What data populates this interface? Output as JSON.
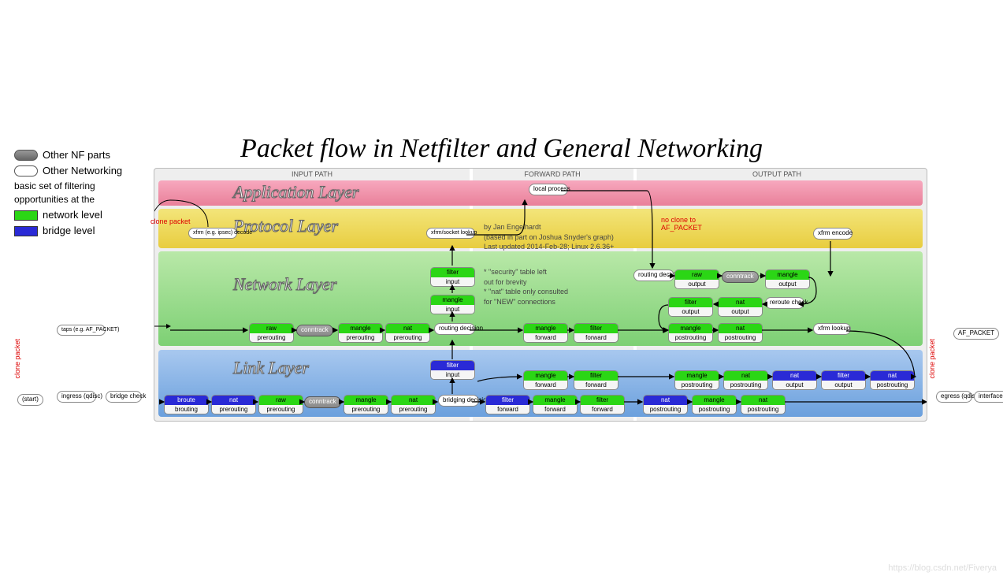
{
  "title": "Packet flow in Netfilter and General Networking",
  "legend": {
    "other_nf": "Other NF parts",
    "other_net": "Other Networking",
    "filtering": "basic set of filtering opportunities at the",
    "net_level": "network level",
    "bridge_level": "bridge level"
  },
  "headers": {
    "input": "INPUT PATH",
    "forward": "FORWARD PATH",
    "output": "OUTPUT PATH"
  },
  "layers": {
    "app": "Application Layer",
    "proto": "Protocol Layer",
    "net": "Network Layer",
    "link": "Link Layer"
  },
  "credits": {
    "l1": "by Jan Engelhardt",
    "l2": "(based in part on Joshua Snyder's graph)",
    "l3": "Last updated 2014-Feb-28; Linux 2.6.36+"
  },
  "notes": {
    "n1": "* \"security\" table left",
    "n2": "  out for brevity",
    "n3": "* \"nat\" table only consulted",
    "n4": "  for \"NEW\" connections"
  },
  "outer": {
    "start": "(start)",
    "ingress": "ingress (qdisc)",
    "bridge_check": "bridge check",
    "taps": "taps (e.g. AF_PACKET)",
    "af_packet": "AF_PACKET",
    "egress": "egress (qdisc)",
    "iface_out": "interface output"
  },
  "net_nodes": {
    "xfrm_decode": "xfrm (e.g. ipsec) decode",
    "xfrm_lookup_sock": "xfrm/socket lookup",
    "conntrack": "conntrack",
    "routing": "routing decision",
    "local_process": "local process",
    "routing_out": "routing decision",
    "conntrack_out": "conntrack",
    "reroute": "reroute check",
    "xfrm_lookup": "xfrm lookup",
    "xfrm_encode": "xfrm encode"
  },
  "link_nodes": {
    "conntrack": "conntrack",
    "bridging": "bridging decision"
  },
  "tables": {
    "filter_input_n": {
      "t": "filter",
      "c": "input"
    },
    "mangle_input_n": {
      "t": "mangle",
      "c": "input"
    },
    "raw_pre_n": {
      "t": "raw",
      "c": "prerouting"
    },
    "mangle_pre_n": {
      "t": "mangle",
      "c": "prerouting"
    },
    "nat_pre_n": {
      "t": "nat",
      "c": "prerouting"
    },
    "mangle_fwd_n": {
      "t": "mangle",
      "c": "forward"
    },
    "filter_fwd_n": {
      "t": "filter",
      "c": "forward"
    },
    "raw_out_n": {
      "t": "raw",
      "c": "output"
    },
    "mangle_out_n": {
      "t": "mangle",
      "c": "output"
    },
    "filter_out_n": {
      "t": "filter",
      "c": "output"
    },
    "nat_out_n": {
      "t": "nat",
      "c": "output"
    },
    "mangle_post_n": {
      "t": "mangle",
      "c": "postrouting"
    },
    "nat_post_n": {
      "t": "nat",
      "c": "postrouting"
    },
    "filter_input_l": {
      "t": "filter",
      "c": "input"
    },
    "broute_l": {
      "t": "broute",
      "c": "brouting"
    },
    "nat_pre_l": {
      "t": "nat",
      "c": "prerouting"
    },
    "raw_pre_lg": {
      "t": "raw",
      "c": "prerouting"
    },
    "mangle_pre_lg": {
      "t": "mangle",
      "c": "prerouting"
    },
    "nat_pre_lg": {
      "t": "nat",
      "c": "prerouting"
    },
    "filter_fwd_l": {
      "t": "filter",
      "c": "forward"
    },
    "mangle_fwd_lg": {
      "t": "mangle",
      "c": "forward"
    },
    "filter_fwd_lg": {
      "t": "filter",
      "c": "forward"
    },
    "mangle_fwd_lg2": {
      "t": "mangle",
      "c": "forward"
    },
    "filter_fwd_lg2": {
      "t": "filter",
      "c": "forward"
    },
    "nat_post_l": {
      "t": "nat",
      "c": "postrouting"
    },
    "mangle_post_lg": {
      "t": "mangle",
      "c": "postrouting"
    },
    "nat_post_lg": {
      "t": "nat",
      "c": "postrouting"
    },
    "mangle_post_lg2": {
      "t": "mangle",
      "c": "postrouting"
    },
    "nat_post_lg2": {
      "t": "nat",
      "c": "postrouting"
    },
    "nat_out_lg": {
      "t": "nat",
      "c": "output"
    },
    "filter_out_lg": {
      "t": "filter",
      "c": "output"
    },
    "nat_post_lbr": {
      "t": "nat",
      "c": "postrouting"
    }
  },
  "red": {
    "clone1": "clone packet",
    "clone2": "clone packet",
    "clone3": "clone packet",
    "no_clone": "no clone to AF_PACKET"
  },
  "watermark": "https://blog.csdn.net/Fiverya"
}
